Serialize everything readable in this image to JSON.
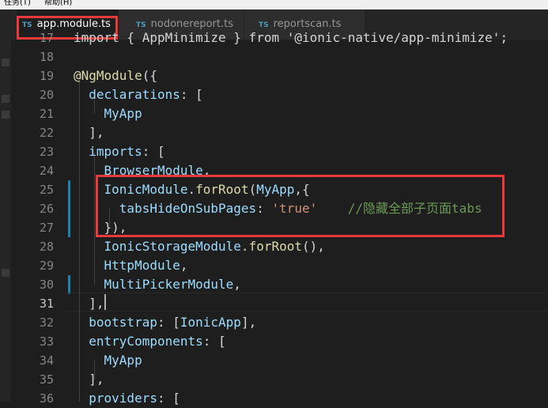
{
  "menubar": {
    "items": [
      "任务(T)",
      "帮助(H)"
    ]
  },
  "tabs": [
    {
      "lang": "TS",
      "name": "app.module.ts",
      "modified": true,
      "active": true
    },
    {
      "lang": "TS",
      "name": "nodonereport.ts",
      "active": false
    },
    {
      "lang": "TS",
      "name": "reportscan.ts",
      "active": false
    }
  ],
  "editor": {
    "current_line": "31",
    "lines": [
      {
        "n": "17",
        "tokens": [
          [
            "d",
            "import { AppMinimize } from '@ionic-native/app-minimize';"
          ]
        ]
      },
      {
        "n": "18",
        "tokens": []
      },
      {
        "n": "19",
        "tokens": [
          [
            "f",
            "@NgModule"
          ],
          [
            "d",
            "({"
          ]
        ]
      },
      {
        "n": "20",
        "tokens": [
          [
            "d",
            "  "
          ],
          [
            "p",
            "declarations"
          ],
          [
            "d",
            ": ["
          ]
        ]
      },
      {
        "n": "21",
        "tokens": [
          [
            "d",
            "    "
          ],
          [
            "p",
            "MyApp"
          ]
        ]
      },
      {
        "n": "22",
        "tokens": [
          [
            "d",
            "  ],"
          ]
        ]
      },
      {
        "n": "23",
        "tokens": [
          [
            "d",
            "  "
          ],
          [
            "p",
            "imports"
          ],
          [
            "d",
            ": ["
          ]
        ]
      },
      {
        "n": "24",
        "tokens": [
          [
            "d",
            "    "
          ],
          [
            "p",
            "BrowserModule"
          ],
          [
            "d",
            ","
          ]
        ]
      },
      {
        "n": "25",
        "tokens": [
          [
            "d",
            "    "
          ],
          [
            "p",
            "IonicModule"
          ],
          [
            "d",
            "."
          ],
          [
            "f",
            "forRoot"
          ],
          [
            "d",
            "("
          ],
          [
            "p",
            "MyApp"
          ],
          [
            "d",
            ",{"
          ]
        ]
      },
      {
        "n": "26",
        "tokens": [
          [
            "d",
            "      "
          ],
          [
            "p",
            "tabsHideOnSubPages"
          ],
          [
            "d",
            ": "
          ],
          [
            "s",
            "'true'"
          ],
          [
            "d",
            "    "
          ],
          [
            "c",
            "//隐藏全部子页面tabs"
          ]
        ]
      },
      {
        "n": "27",
        "tokens": [
          [
            "d",
            "    }),"
          ]
        ]
      },
      {
        "n": "28",
        "tokens": [
          [
            "d",
            "    "
          ],
          [
            "p",
            "IonicStorageModule"
          ],
          [
            "d",
            "."
          ],
          [
            "f",
            "forRoot"
          ],
          [
            "d",
            "(),"
          ]
        ]
      },
      {
        "n": "29",
        "tokens": [
          [
            "d",
            "    "
          ],
          [
            "p",
            "HttpModule"
          ],
          [
            "d",
            ","
          ]
        ]
      },
      {
        "n": "30",
        "tokens": [
          [
            "d",
            "    "
          ],
          [
            "p",
            "MultiPickerModule"
          ],
          [
            "d",
            ","
          ]
        ]
      },
      {
        "n": "31",
        "tokens": [
          [
            "d",
            "  ],"
          ]
        ]
      },
      {
        "n": "32",
        "tokens": [
          [
            "d",
            "  "
          ],
          [
            "p",
            "bootstrap"
          ],
          [
            "d",
            ": ["
          ],
          [
            "p",
            "IonicApp"
          ],
          [
            "d",
            "],"
          ]
        ]
      },
      {
        "n": "33",
        "tokens": [
          [
            "d",
            "  "
          ],
          [
            "p",
            "entryComponents"
          ],
          [
            "d",
            ": ["
          ]
        ]
      },
      {
        "n": "34",
        "tokens": [
          [
            "d",
            "    "
          ],
          [
            "p",
            "MyApp"
          ]
        ]
      },
      {
        "n": "35",
        "tokens": [
          [
            "d",
            "  ],"
          ]
        ]
      },
      {
        "n": "36",
        "tokens": [
          [
            "d",
            "  "
          ],
          [
            "p",
            "providers"
          ],
          [
            "d",
            ": ["
          ]
        ]
      }
    ]
  },
  "colors": {
    "highlight_border": "#e8393b",
    "keyword": "#569cd6",
    "property": "#9cdcfe",
    "function": "#dcdcaa",
    "string": "#ce9178",
    "comment": "#6a9955",
    "ts_badge": "#519aba"
  }
}
